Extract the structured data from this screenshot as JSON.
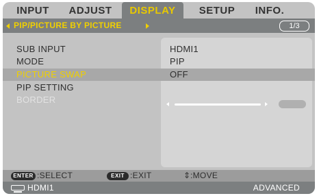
{
  "tabs": [
    {
      "label": "INPUT"
    },
    {
      "label": "ADJUST"
    },
    {
      "label": "DISPLAY"
    },
    {
      "label": "SETUP"
    },
    {
      "label": "INFO."
    }
  ],
  "active_tab": "DISPLAY",
  "subtitle": "PIP/PICTURE BY PICTURE",
  "page_indicator": "1/3",
  "menu": [
    {
      "label": "SUB INPUT",
      "value": "HDMI1"
    },
    {
      "label": "MODE",
      "value": "PIP"
    },
    {
      "label": "PICTURE SWAP",
      "value": "OFF"
    },
    {
      "label": "PIP SETTING",
      "value": ""
    },
    {
      "label": "BORDER",
      "value": ""
    }
  ],
  "selected_item": "PICTURE SWAP",
  "disabled_item": "BORDER",
  "hints": {
    "enter_key": "ENTER",
    "enter_action": ":SELECT",
    "exit_key": "EXIT",
    "exit_action": ":EXIT",
    "move_symbol": "⇕",
    "move_action": ":MOVE"
  },
  "status": {
    "input": "HDMI1",
    "mode": "ADVANCED"
  },
  "colors": {
    "background": "#c3c3c3",
    "bar": "#7c7f80",
    "highlight": "#f0d000"
  },
  "icons": [
    "left-triangle-icon",
    "right-triangle-icon",
    "hdmi-input-icon",
    "up-down-arrow-icon"
  ]
}
